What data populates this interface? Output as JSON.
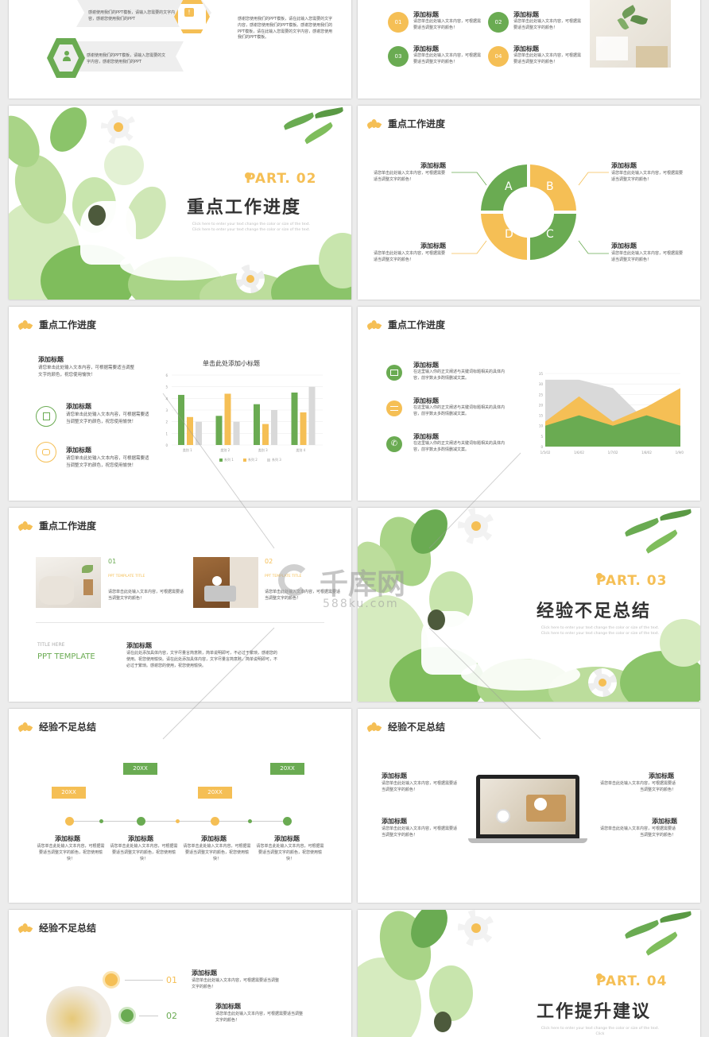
{
  "colors": {
    "green": "#6aab52",
    "yellow": "#f5bf55"
  },
  "s1": {
    "top_text": "感谢使用我们的PPT模板，请输入您需要的文字内容，感谢您使用我们的PPT",
    "bottom_text": "感谢使用我们的PPT模板，请输入您需要的文字内容，感谢您使用我们的PPT",
    "right_text": "感谢您使用我们的PPT模板，请在此输入您需要的文字内容，感谢您使用我们的PPT模板。感谢您使用我们的PPT模板，请在此输入您需要的文字内容，感谢您使用我们的PPT模板。"
  },
  "s2": {
    "items": [
      {
        "num": "01",
        "title": "添加标题",
        "text": "请您单击此处输入文本内容，可根据需要适当调整文字的颜色！"
      },
      {
        "num": "02",
        "title": "添加标题",
        "text": "请您单击此处输入文本内容，可根据需要适当调整文字的颜色！"
      },
      {
        "num": "03",
        "title": "添加标题",
        "text": "请您单击此处输入文本内容，可根据需要适当调整文字的颜色！"
      },
      {
        "num": "04",
        "title": "添加标题",
        "text": "请您单击此处输入文本内容，可根据需要适当调整文字的颜色！"
      }
    ]
  },
  "cover2": {
    "part": "PART. 02",
    "title": "重点工作进度",
    "sub": "Click here to enter your text change the color or size of the text. Click here to enter your text change the color or size of the text."
  },
  "cycle": {
    "header": "重点工作进度",
    "letters": [
      "A",
      "B",
      "C",
      "D"
    ],
    "items": [
      {
        "title": "添加标题",
        "text": "请您单击此处输入文本内容，可根据需要适当调整文字的颜色！"
      },
      {
        "title": "添加标题",
        "text": "请您单击此处输入文本内容，可根据需要适当调整文字的颜色！"
      },
      {
        "title": "添加标题",
        "text": "请您单击此处输入文本内容，可根据需要适当调整文字的颜色！"
      },
      {
        "title": "添加标题",
        "text": "请您单击此处输入文本内容，可根据需要适当调整文字的颜色！"
      }
    ]
  },
  "barslide": {
    "header": "重点工作进度",
    "top_title": "添加标题",
    "top_text": "请您单击此处输入文本内容，可根据需要适当调整文字的颜色，祝您使用愉快！",
    "items": [
      {
        "title": "添加标题",
        "text": "请您单击此处输入文本内容，可根据需要适当调整文字的颜色，祝您使用愉快！"
      },
      {
        "title": "添加标题",
        "text": "请您单击此处输入文本内容，可根据需要适当调整文字的颜色，祝您使用愉快！"
      }
    ]
  },
  "areaslide": {
    "header": "重点工作进度",
    "items": [
      {
        "title": "添加标题",
        "text": "在这里输入你的正文阐述与关键词标题相关的具体内容，前字数太多酌情删减文案。"
      },
      {
        "title": "添加标题",
        "text": "在这里输入你的正文阐述与关键词标题相关的具体内容，前字数太多酌情删减文案。"
      },
      {
        "title": "添加标题",
        "text": "在这里输入你的正文阐述与关键词标题相关的具体内容，前字数太多酌情删减文案。"
      }
    ]
  },
  "photoslide": {
    "header": "重点工作进度",
    "items": [
      {
        "num": "01",
        "sub": "PPT TEMPLATE TITLE",
        "text": "请您单击此处输入文本内容，可根据需要适当调整文字的颜色！"
      },
      {
        "num": "02",
        "sub": "PPT TEMPLATE TITLE",
        "text": "请您单击此处输入文本内容，可根据需要适当调整文字的颜色！"
      }
    ],
    "title_here": "TITLE HERE",
    "ppt_template": "PPT TEMPLATE",
    "add_title": "添加标题",
    "body": "请在此处添加具体内容，文字尽量言简意赅，简单说明即可，不必过于繁琐，感谢您的使用。祝您使用愉快。请在此处添加具体内容，文字尽量言简意赅，简单说明即可，不必过于繁琐。感谢您的使用，祝您使用愉快。"
  },
  "cover3": {
    "part": "PART. 03",
    "title": "经验不足总结",
    "sub": "Click here to enter your text change the color or size of the text. Click here to enter your text change the color or size of the text."
  },
  "watermark": {
    "brand": "千库网",
    "url": "588ku.com"
  },
  "timeline": {
    "header": "经验不足总结",
    "tags": [
      "20XX",
      "20XX",
      "20XX",
      "20XX"
    ],
    "items": [
      {
        "title": "添加标题",
        "text": "请您单击此处输入文本内容，可根据需要适当调整文字的颜色，祝您使用愉快！"
      },
      {
        "title": "添加标题",
        "text": "请您单击此处输入文本内容，可根据需要适当调整文字的颜色，祝您使用愉快！"
      },
      {
        "title": "添加标题",
        "text": "请您单击此处输入文本内容，可根据需要适当调整文字的颜色，祝您使用愉快！"
      },
      {
        "title": "添加标题",
        "text": "请您单击此处输入文本内容，可根据需要适当调整文字的颜色，祝您使用愉快！"
      }
    ]
  },
  "laptop": {
    "header": "经验不足总结",
    "items": [
      {
        "title": "添加标题",
        "text": "请您单击此处输入文本内容，可根据需要适当调整文字的颜色！"
      },
      {
        "title": "添加标题",
        "text": "请您单击此处输入文本内容，可根据需要适当调整文字的颜色！"
      },
      {
        "title": "添加标题",
        "text": "请您单击此处输入文本内容，可根据需要适当调整文字的颜色！"
      },
      {
        "title": "添加标题",
        "text": "请您单击此处输入文本内容，可根据需要适当调整文字的颜色！"
      }
    ]
  },
  "lastleft": {
    "header": "经验不足总结",
    "items": [
      {
        "num": "01",
        "title": "添加标题",
        "text": "请您单击此处输入文本内容，可根据需要适当调整文字的颜色！"
      },
      {
        "num": "02",
        "title": "添加标题",
        "text": "请您单击此处输入文本内容，可根据需要适当调整文字的颜色！"
      }
    ]
  },
  "cover4": {
    "part": "PART. 04",
    "title": "工作提升建议",
    "sub": "Click here to enter your text change the color or size of the text. Click"
  },
  "chart_data": [
    {
      "type": "bar",
      "title": "单击此处添加小标题",
      "categories": [
        "类别 1",
        "类别 2",
        "类别 3",
        "类别 4"
      ],
      "series": [
        {
          "name": "系列 1",
          "values": [
            4.3,
            2.5,
            3.5,
            4.5
          ]
        },
        {
          "name": "系列 2",
          "values": [
            2.4,
            4.4,
            1.8,
            2.8
          ]
        },
        {
          "name": "系列 3",
          "values": [
            2,
            2,
            3,
            5
          ]
        }
      ],
      "ylim": [
        0,
        6
      ],
      "yticks": [
        "0",
        "1",
        "2",
        "3",
        "4",
        "5",
        "6"
      ],
      "colors": [
        "#6aab52",
        "#f5bf55",
        "#d9d9d9"
      ]
    },
    {
      "type": "area",
      "categories": [
        "1/5/02",
        "1/6/02",
        "1/7/02",
        "1/8/02",
        "1/9/02"
      ],
      "series": [
        {
          "values": [
            32,
            32,
            28,
            12,
            15
          ]
        },
        {
          "values": [
            12,
            24,
            12,
            19,
            28
          ]
        },
        {
          "values": [
            10,
            15,
            10,
            15,
            10
          ]
        }
      ],
      "ylim": [
        0,
        35
      ],
      "yticks": [
        "0",
        "5",
        "10",
        "15",
        "20",
        "25",
        "30",
        "35"
      ],
      "colors": [
        "#d9d9d9",
        "#f5bf55",
        "#6aab52"
      ]
    }
  ]
}
